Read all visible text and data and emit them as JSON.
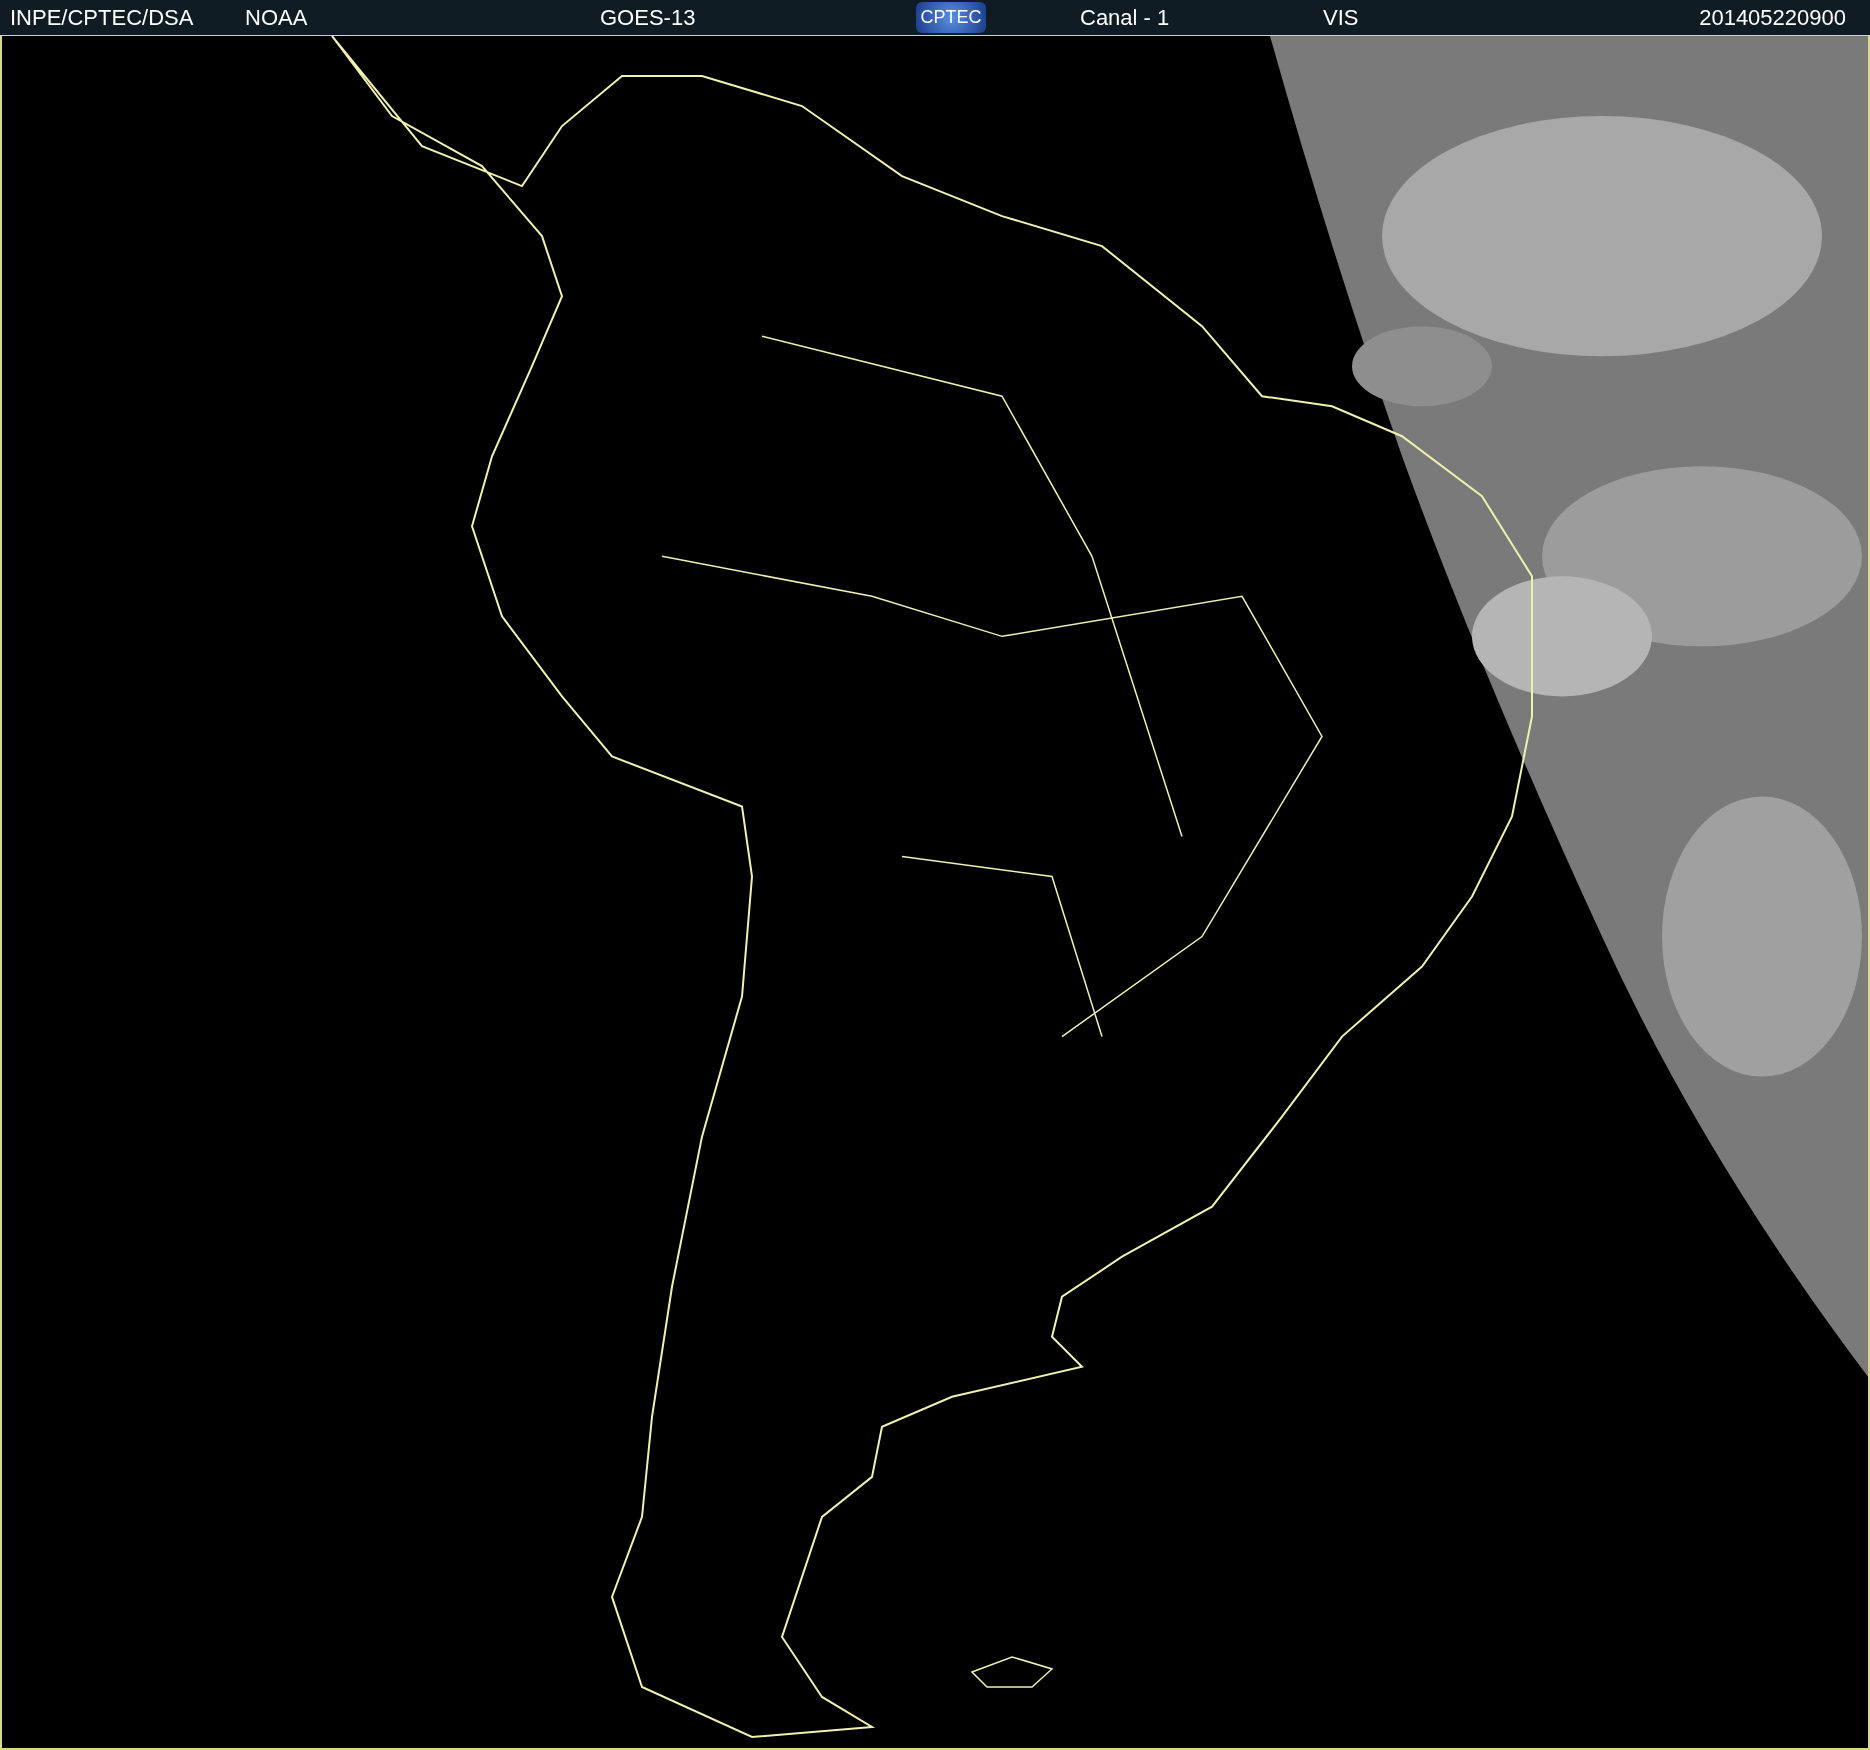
{
  "header": {
    "source": "INPE/CPTEC/DSA",
    "agency": "NOAA",
    "satellite": "GOES-13",
    "logo": "CPTEC",
    "channel": "Canal - 1",
    "band": "VIS",
    "timestamp": "201405220900"
  }
}
